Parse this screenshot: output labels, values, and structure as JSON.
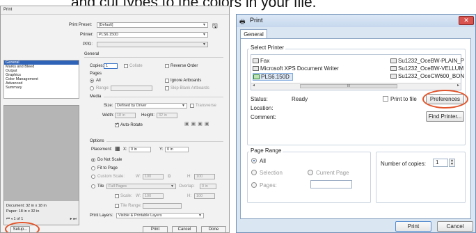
{
  "caption": "and cut types to the colors in your file.",
  "left_dialog": {
    "title": "Print",
    "print_preset_label": "Print Preset:",
    "print_preset_value": "[Default]",
    "printer_label": "Printer:",
    "printer_value": "PLS6.150D",
    "ppd_label": "PPD:",
    "general_section": "General",
    "copies_label": "Copies:",
    "copies_value": "1",
    "collate_label": "Collate",
    "reverse_order_label": "Reverse Order",
    "pages_label": "Pages",
    "all_label": "All",
    "range_label": "Range:",
    "ignore_artboards_label": "Ignore Artboards",
    "skip_blank_label": "Skip Blank Artboards",
    "categories": [
      "General",
      "Marks and Bleed",
      "Output",
      "Graphics",
      "Color Management",
      "Advanced",
      "Summary"
    ],
    "media_section": "Media",
    "size_label": "Size:",
    "size_value": "Defined by Driver",
    "transverse_label": "Transverse",
    "width_label": "Width:",
    "width_value": "18 in",
    "height_label": "Height:",
    "height_value": "32 in",
    "auto_rotate_label": "Auto-Rotate",
    "options_section": "Options",
    "placement_label": "Placement:",
    "x_label": "X:",
    "x_value": "0 in",
    "y_label": "Y:",
    "y_value": "0 in",
    "do_not_scale_label": "Do Not Scale",
    "fit_to_page_label": "Fit to Page",
    "custom_scale_label": "Custom Scale:",
    "w_label": "W:",
    "h_label": "H:",
    "scale_value": "100",
    "tile_label": "Tile",
    "tile_value": "Full Pages",
    "overlap_label": "Overlap:",
    "overlap_value": "0 in",
    "scale_label": "Scale:",
    "tile_range_label": "Tile Range:",
    "document_info": "Document: 32 in x 18 in",
    "paper_info": "Paper: 18 in x 32 in",
    "page_nav": "1 of 1",
    "print_layers_label": "Print Layers:",
    "print_layers_value": "Visible & Printable Layers",
    "setup_button": "Setup...",
    "print_button": "Print",
    "cancel_button": "Cancel",
    "done_button": "Done"
  },
  "right_dialog": {
    "title": "Print",
    "tab_general": "General",
    "select_printer_group": "Select Printer",
    "printers_col1": [
      "Fax",
      "Microsoft XPS Document Writer",
      "PLS6.150D"
    ],
    "printers_col2": [
      "Su1232_OceBW-PLAIN_P",
      "Su1232_OceBW-VELLUM",
      "Su1232_OceCW600_BON"
    ],
    "scroll_indicator": "III",
    "status_label": "Status:",
    "status_value": "Ready",
    "location_label": "Location:",
    "comment_label": "Comment:",
    "print_to_file_label": "Print to file",
    "preferences_button": "Preferences",
    "find_printer_button": "Find Printer...",
    "page_range_group": "Page Range",
    "all_label": "All",
    "selection_label": "Selection",
    "current_page_label": "Current Page",
    "pages_label": "Pages:",
    "number_of_copies_label": "Number of copies:",
    "copies_value": "1",
    "print_button": "Print",
    "cancel_button": "Cancel"
  },
  "colors": {
    "highlight_ellipse": "#e2542a",
    "selection_blue": "#2f63b8"
  }
}
